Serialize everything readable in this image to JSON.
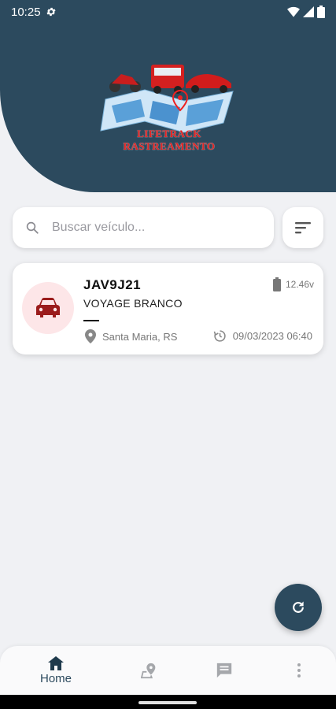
{
  "status_bar": {
    "time": "10:25",
    "icons": [
      "settings-icon",
      "wifi-icon",
      "signal-icon",
      "battery-icon"
    ]
  },
  "header": {
    "brand_line1": "LIFETRACK",
    "brand_line2": "RASTREAMENTO",
    "bg_color": "#2c4a5e"
  },
  "search": {
    "placeholder": "Buscar veículo..."
  },
  "vehicles": [
    {
      "plate": "JAV9J21",
      "model": "VOYAGE BRANCO",
      "status": "—",
      "battery": "12.46v",
      "location": "Santa Maria, RS",
      "datetime": "09/03/2023 06:40"
    }
  ],
  "nav": {
    "items": [
      {
        "label": "Home",
        "icon": "home-icon",
        "active": true
      },
      {
        "label": "",
        "icon": "map-pin-icon",
        "active": false
      },
      {
        "label": "",
        "icon": "message-icon",
        "active": false
      },
      {
        "label": "",
        "icon": "more-vert-icon",
        "active": false
      }
    ]
  },
  "colors": {
    "primary": "#2c4a5e",
    "accent": "#9b1c1c",
    "card_icon_bg": "#fde6e8"
  }
}
